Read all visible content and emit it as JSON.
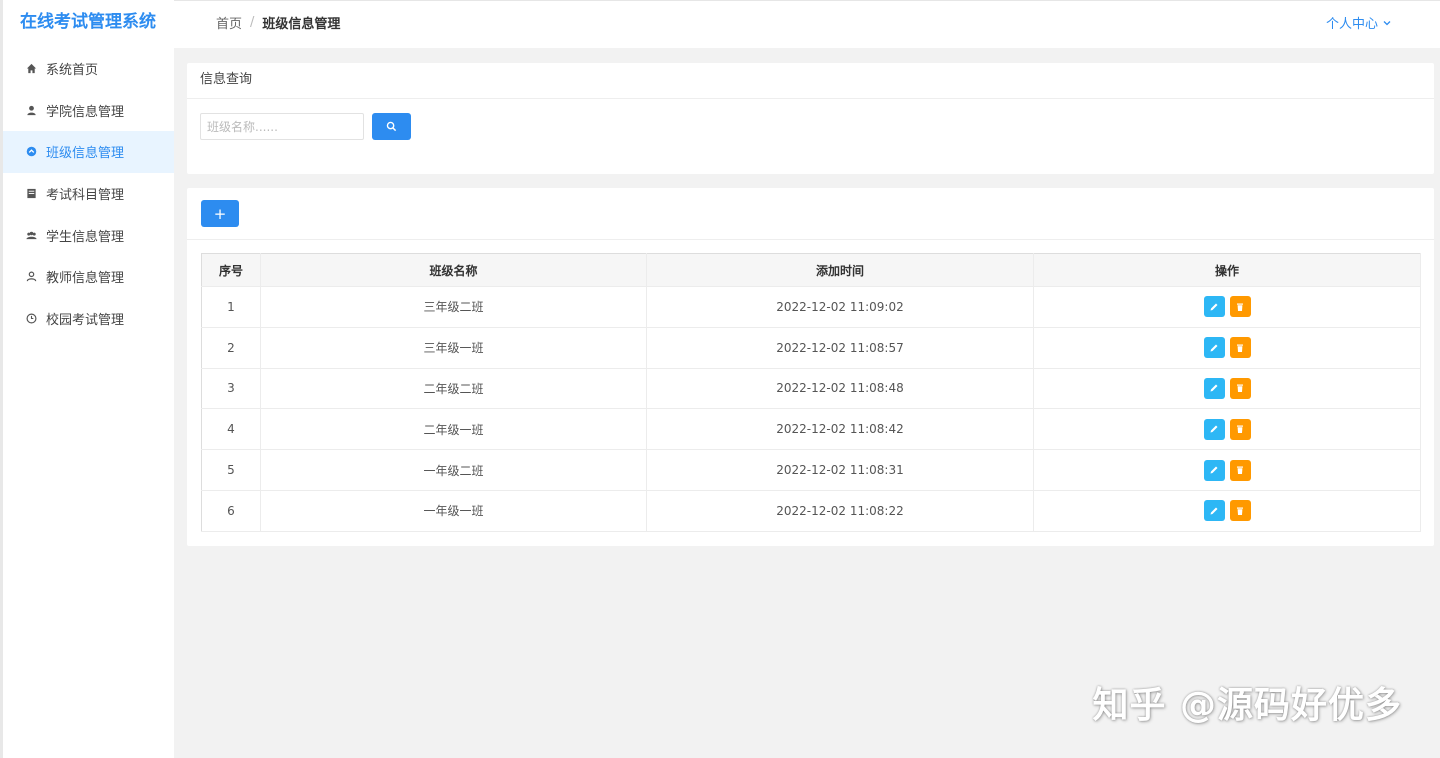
{
  "app": {
    "title": "在线考试管理系统"
  },
  "sidebar": {
    "items": [
      {
        "label": "系统首页",
        "icon": "home-icon",
        "active": false
      },
      {
        "label": "学院信息管理",
        "icon": "user-icon",
        "active": false
      },
      {
        "label": "班级信息管理",
        "icon": "circle-icon",
        "active": true
      },
      {
        "label": "考试科目管理",
        "icon": "book-icon",
        "active": false
      },
      {
        "label": "学生信息管理",
        "icon": "group-icon",
        "active": false
      },
      {
        "label": "教师信息管理",
        "icon": "teacher-icon",
        "active": false
      },
      {
        "label": "校园考试管理",
        "icon": "clock-icon",
        "active": false
      }
    ]
  },
  "header": {
    "breadcrumb": {
      "home": "首页",
      "separator": "/",
      "current": "班级信息管理"
    },
    "user_menu": "个人中心"
  },
  "search": {
    "title": "信息查询",
    "placeholder": "班级名称......",
    "value": ""
  },
  "toolbar": {
    "add_label": "+"
  },
  "table": {
    "headers": {
      "index": "序号",
      "name": "班级名称",
      "time": "添加时间",
      "ops": "操作"
    },
    "rows": [
      {
        "index": "1",
        "name": "三年级二班",
        "time": "2022-12-02 11:09:02"
      },
      {
        "index": "2",
        "name": "三年级一班",
        "time": "2022-12-02 11:08:57"
      },
      {
        "index": "3",
        "name": "二年级二班",
        "time": "2022-12-02 11:08:48"
      },
      {
        "index": "4",
        "name": "二年级一班",
        "time": "2022-12-02 11:08:42"
      },
      {
        "index": "5",
        "name": "一年级二班",
        "time": "2022-12-02 11:08:31"
      },
      {
        "index": "6",
        "name": "一年级一班",
        "time": "2022-12-02 11:08:22"
      }
    ]
  },
  "watermark": {
    "credit": "知乎 @源码好优多"
  },
  "colors": {
    "primary": "#2d8cf0",
    "edit": "#2db7f5",
    "delete": "#ff9900",
    "active_bg": "#e8f4ff"
  }
}
